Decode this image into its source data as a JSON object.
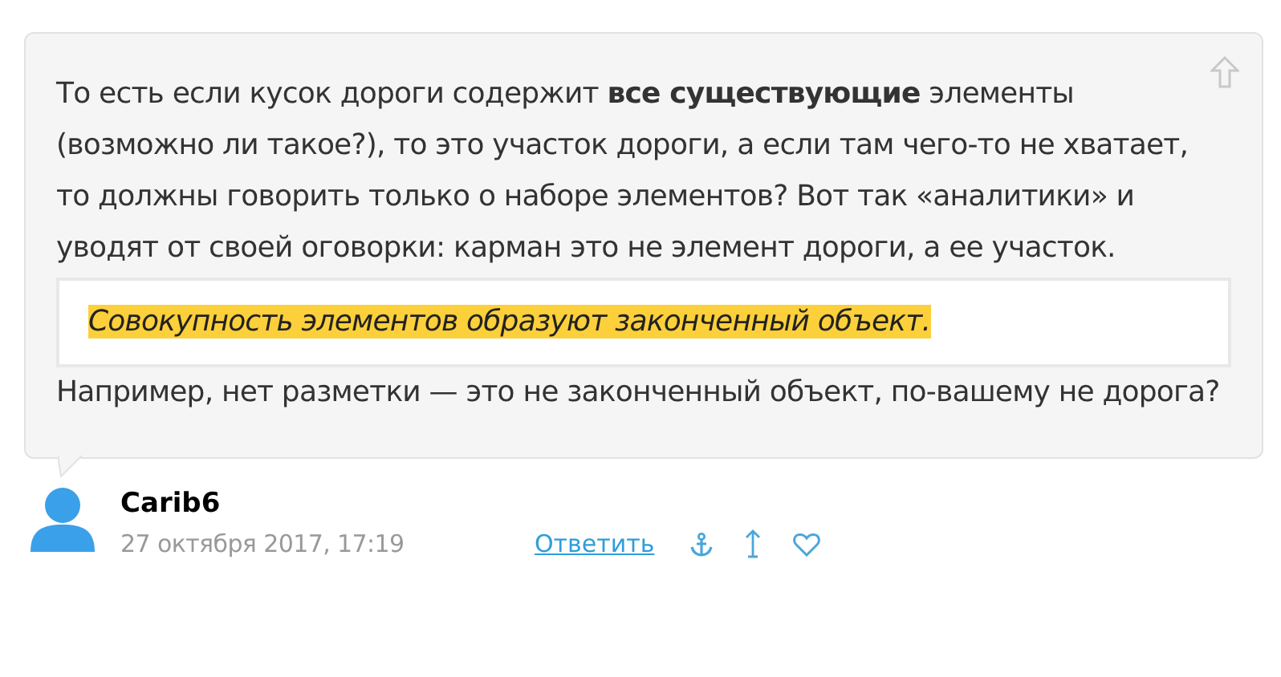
{
  "comment": {
    "paragraph_1": "То есть если кусок дороги содержит **все существующие** элементы (возможно ли такое?), то это участок дороги, а если там чего-то не хватает, то должны говорить только о наборе элементов? Вот так «аналитики» и уводят от своей оговорки: карман это не элемент дороги, а ее участок.",
    "quote": "Совокупность элементов образуют законченный объект.",
    "paragraph_2": "Например, нет разметки — это не законченный объект, по-вашему не дорога?"
  },
  "author": {
    "name": "Carib6",
    "date": "27 октября 2017, 17:19"
  },
  "actions": {
    "reply": "Ответить"
  }
}
